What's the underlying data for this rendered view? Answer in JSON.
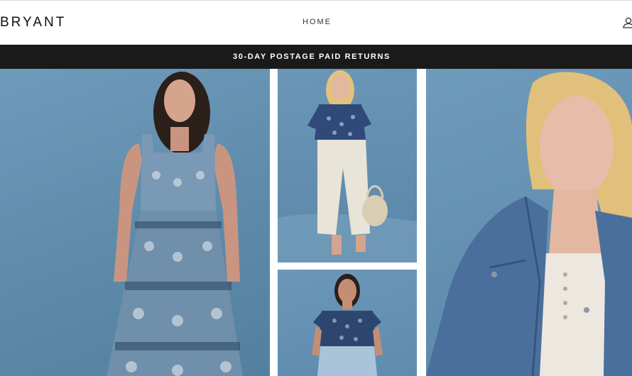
{
  "header": {
    "logo": "BRYANT",
    "nav": {
      "home_label": "HOME"
    },
    "account_icon": "user-icon"
  },
  "banner": {
    "text": "30-DAY POSTAGE PAID RETURNS",
    "background": "#1a1a1a",
    "text_color": "#ffffff"
  },
  "hero": {
    "images": [
      {
        "name": "woman in blue printed sundress"
      },
      {
        "name": "woman in floral top and white wide-leg pants"
      },
      {
        "name": "woman in ruffled blue top and light jeans"
      },
      {
        "name": "woman in denim jacket portrait"
      }
    ],
    "backdrop_color": "#6a97b8"
  }
}
